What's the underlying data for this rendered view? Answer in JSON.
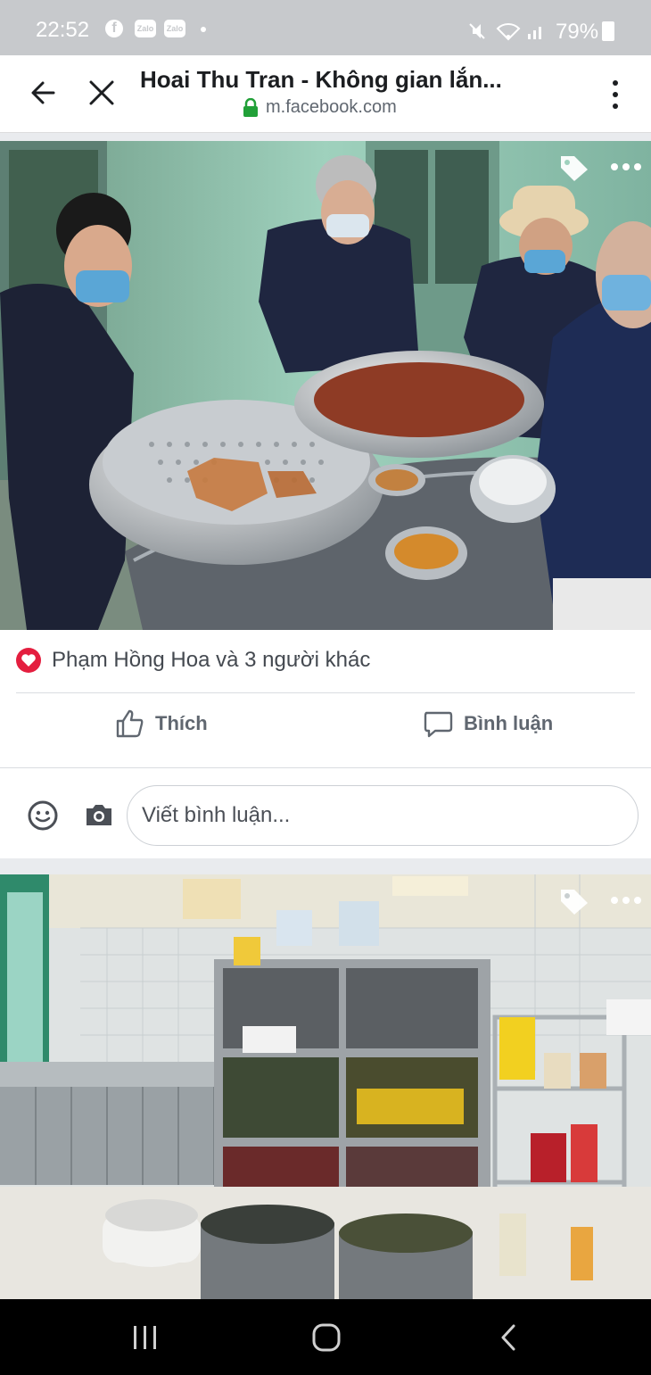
{
  "status_bar": {
    "time": "22:52",
    "notification_icons": [
      "f",
      "Zalo",
      "Zalo"
    ],
    "battery": "79%"
  },
  "browser": {
    "title": "Hoai Thu Tran - Không gian lắn...",
    "url": "m.facebook.com"
  },
  "post": {
    "reactions_text": "Phạm Hồng Hoa và 3 người khác",
    "like_label": "Thích",
    "comment_label": "Bình luận",
    "comment_placeholder": "Viết bình luận..."
  },
  "colors": {
    "reaction_heart": "#e41e3f",
    "secure_lock": "#21a038",
    "navbar": "#000000",
    "status_bar": "#c7c9cc"
  },
  "icons": [
    "back-arrow-icon",
    "close-icon",
    "lock-icon",
    "more-vert-icon",
    "tag-icon",
    "more-horiz-icon",
    "heart-icon",
    "like-icon",
    "comment-icon",
    "smile-icon",
    "camera-icon",
    "recents-icon",
    "home-icon",
    "nav-back-icon"
  ]
}
